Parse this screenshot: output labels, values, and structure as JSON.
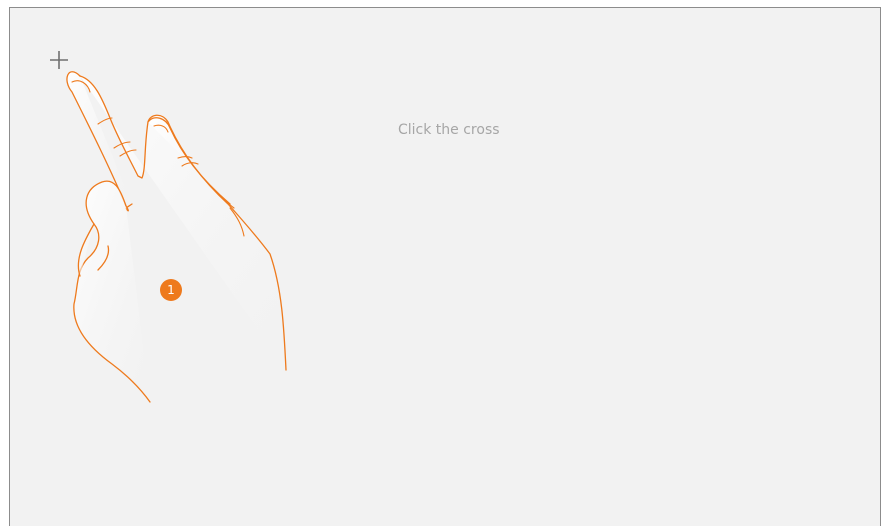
{
  "instruction": {
    "text": "Click the cross"
  },
  "cross": {
    "icon": "plus-icon",
    "color": "#707070"
  },
  "hand": {
    "icon": "hand-pointer-icon",
    "stroke_color": "#ee7a1d"
  },
  "step": {
    "number": "1",
    "color": "#ee7a1d"
  },
  "colors": {
    "background": "#f2f2f2",
    "border": "#8c8c8c",
    "text": "#a6a6a6"
  }
}
